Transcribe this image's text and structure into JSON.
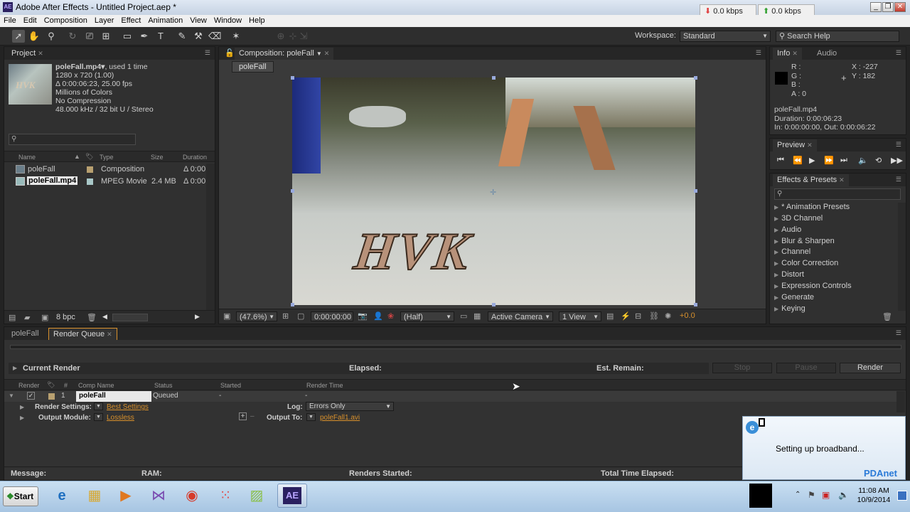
{
  "window": {
    "title": "Adobe After Effects - Untitled Project.aep *",
    "app_icon": "AE",
    "net_down": "0.0 kbps",
    "net_up": "0.0 kbps"
  },
  "menu": [
    "File",
    "Edit",
    "Composition",
    "Layer",
    "Effect",
    "Animation",
    "View",
    "Window",
    "Help"
  ],
  "toolbar": {
    "workspace_label": "Workspace:",
    "workspace_value": "Standard",
    "search_help": "Search Help"
  },
  "project": {
    "tab": "Project",
    "footage_name": "poleFall.mp4▾",
    "footage_used": ", used 1 time",
    "footage_info": [
      "1280 x 720 (1.00)",
      "Δ 0:00:06:23, 25.00 fps",
      "Millions of Colors",
      "No Compression",
      "48.000 kHz / 32 bit U / Stereo"
    ],
    "thumb_text": "HVK",
    "columns": [
      "Name",
      "Type",
      "Size",
      "Duration"
    ],
    "items": [
      {
        "name": "poleFall",
        "type": "Composition",
        "size": "",
        "duration": "Δ 0:00",
        "color": "#b8a070"
      },
      {
        "name": "poleFall.mp4",
        "type": "MPEG Movie",
        "size": "2.4 MB",
        "duration": "Δ 0:00",
        "color": "#a9c8c8"
      }
    ],
    "bpc": "8 bpc"
  },
  "composition": {
    "tab": "Composition: poleFall",
    "comp_button": "poleFall",
    "viewer_text": "HVK",
    "zoom": "(47.6%)",
    "timecode": "0:00:00:00",
    "resolution": "(Half)",
    "camera": "Active Camera",
    "views": "1 View",
    "exposure": "+0.0"
  },
  "info": {
    "tab_info": "Info",
    "tab_audio": "Audio",
    "r": "R :",
    "g": "G :",
    "b": "B :",
    "a": "A : 0",
    "x": "X : -227",
    "y": "Y : 182",
    "name": "poleFall.mp4",
    "duration": "Duration: 0:00:06:23",
    "inout": "In: 0:00:00:00, Out: 0:00:06:22"
  },
  "preview": {
    "tab": "Preview"
  },
  "effects": {
    "tab": "Effects & Presets",
    "items": [
      "* Animation Presets",
      "3D Channel",
      "Audio",
      "Blur & Sharpen",
      "Channel",
      "Color Correction",
      "Distort",
      "Expression Controls",
      "Generate",
      "Keying"
    ]
  },
  "render_queue": {
    "tab_comp": "poleFall",
    "tab_rq": "Render Queue",
    "current_render": "Current Render",
    "elapsed": "Elapsed:",
    "est_remain": "Est. Remain:",
    "stop": "Stop",
    "pause": "Pause",
    "render": "Render",
    "columns": [
      "Render",
      "#",
      "Comp Name",
      "Status",
      "Started",
      "Render Time"
    ],
    "row": {
      "num": "1",
      "comp": "poleFall",
      "status": "Queued",
      "started": "-",
      "render_time": "-"
    },
    "render_settings_label": "Render Settings:",
    "render_settings_value": "Best Settings",
    "log_label": "Log:",
    "log_value": "Errors Only",
    "output_module_label": "Output Module:",
    "output_module_value": "Lossless",
    "output_to_label": "Output To:",
    "output_to_value": "poleFall1.avi",
    "footer": {
      "message": "Message:",
      "ram": "RAM:",
      "renders_started": "Renders Started:",
      "total_elapsed": "Total Time Elapsed:"
    }
  },
  "notification": {
    "text": "Setting up broadband...",
    "brand": "PDAnet"
  },
  "taskbar": {
    "start": "Start",
    "time": "11:08 AM",
    "date": "10/9/2014",
    "active_app": "AE"
  }
}
